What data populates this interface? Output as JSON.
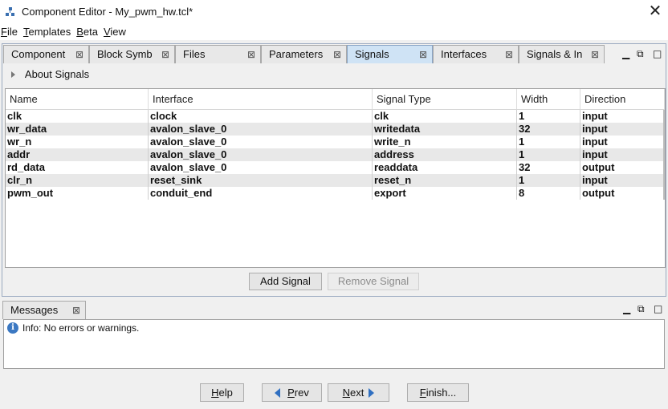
{
  "window": {
    "title": "Component Editor - My_pwm_hw.tcl*",
    "close_glyph": "✕"
  },
  "menu": [
    {
      "label": "File",
      "mnemonic": "F",
      "rest": "ile"
    },
    {
      "label": "Templates",
      "mnemonic": "T",
      "rest": "emplates"
    },
    {
      "label": "Beta",
      "mnemonic": "B",
      "rest": "eta"
    },
    {
      "label": "View",
      "mnemonic": "V",
      "rest": "iew"
    }
  ],
  "tabs": [
    {
      "label": "Component",
      "active": false
    },
    {
      "label": "Block Symb",
      "active": false
    },
    {
      "label": "Files",
      "active": false
    },
    {
      "label": "Parameters",
      "active": false
    },
    {
      "label": "Signals",
      "active": true
    },
    {
      "label": "Interfaces",
      "active": false
    },
    {
      "label": "Signals & In",
      "active": false
    }
  ],
  "tab_close_glyph": "⊠",
  "window_controls": {
    "minimize": "▁",
    "restore": "⧉",
    "maximize": "□"
  },
  "about": {
    "label": "About Signals"
  },
  "signals_table": {
    "columns": [
      "Name",
      "Interface",
      "Signal Type",
      "Width",
      "Direction"
    ],
    "rows": [
      [
        "clk",
        "clock",
        "clk",
        "1",
        "input"
      ],
      [
        "wr_data",
        "avalon_slave_0",
        "writedata",
        "32",
        "input"
      ],
      [
        "wr_n",
        "avalon_slave_0",
        "write_n",
        "1",
        "input"
      ],
      [
        "addr",
        "avalon_slave_0",
        "address",
        "1",
        "input"
      ],
      [
        "rd_data",
        "avalon_slave_0",
        "readdata",
        "32",
        "output"
      ],
      [
        "clr_n",
        "reset_sink",
        "reset_n",
        "1",
        "input"
      ],
      [
        "pwm_out",
        "conduit_end",
        "export",
        "8",
        "output"
      ]
    ]
  },
  "buttons": {
    "add_signal": "Add Signal",
    "remove_signal": "Remove Signal"
  },
  "messages": {
    "tab_label": "Messages",
    "info_line": "Info: No errors or warnings."
  },
  "nav": {
    "help": {
      "mnemonic": "H",
      "rest": "elp"
    },
    "prev": {
      "mnemonic": "P",
      "rest": "rev"
    },
    "next": {
      "mnemonic": "N",
      "rest": "ext"
    },
    "finish": {
      "mnemonic": "F",
      "rest": "inish..."
    }
  },
  "colors": {
    "active_tab": "#cfe3f5",
    "nav_arrow": "#2f6fc1",
    "info_icon": "#3b78c2"
  }
}
